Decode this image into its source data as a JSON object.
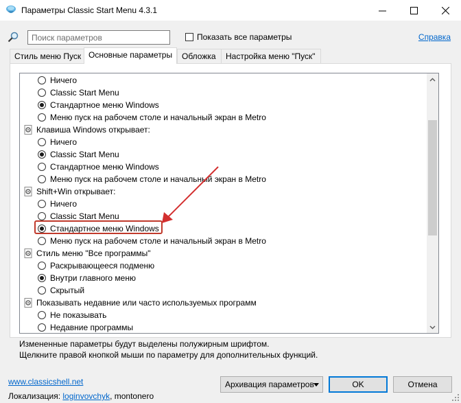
{
  "window": {
    "title": "Параметры Classic Start Menu 4.3.1"
  },
  "search": {
    "placeholder": "Поиск параметров",
    "value": ""
  },
  "show_all_label": "Показать все параметры",
  "help_link": "Справка",
  "tabs": [
    {
      "label": "Стиль меню Пуск",
      "active": false
    },
    {
      "label": "Основные параметры",
      "active": true
    },
    {
      "label": "Обложка",
      "active": false
    },
    {
      "label": "Настройка меню \"Пуск\"",
      "active": false
    }
  ],
  "settings": [
    {
      "type": "option",
      "label": "Ничего",
      "checked": false
    },
    {
      "type": "option",
      "label": "Classic Start Menu",
      "checked": false
    },
    {
      "type": "option",
      "label": "Стандартное меню Windows",
      "checked": true
    },
    {
      "type": "option",
      "label": "Меню пуск на рабочем столе и начальный экран в Metro",
      "checked": false
    },
    {
      "type": "group",
      "label": "Клавиша Windows открывает:"
    },
    {
      "type": "option",
      "label": "Ничего",
      "checked": false
    },
    {
      "type": "option",
      "label": "Classic Start Menu",
      "checked": true
    },
    {
      "type": "option",
      "label": "Стандартное меню Windows",
      "checked": false
    },
    {
      "type": "option",
      "label": "Меню пуск на рабочем столе и начальный экран в Metro",
      "checked": false
    },
    {
      "type": "group",
      "label": "Shift+Win открывает:"
    },
    {
      "type": "option",
      "label": "Ничего",
      "checked": false
    },
    {
      "type": "option",
      "label": "Classic Start Menu",
      "checked": false
    },
    {
      "type": "option",
      "label": "Стандартное меню Windows",
      "checked": true
    },
    {
      "type": "option",
      "label": "Меню пуск на рабочем столе и начальный экран в Metro",
      "checked": false
    },
    {
      "type": "group",
      "label": "Стиль меню \"Все программы\""
    },
    {
      "type": "option",
      "label": "Раскрывающееся подменю",
      "checked": false
    },
    {
      "type": "option",
      "label": "Внутри главного меню",
      "checked": true
    },
    {
      "type": "option",
      "label": "Скрытый",
      "checked": false
    },
    {
      "type": "group",
      "label": "Показывать недавние или часто используемых программ"
    },
    {
      "type": "option",
      "label": "Не показывать",
      "checked": false
    },
    {
      "type": "option",
      "label": "Недавние программы",
      "checked": false
    }
  ],
  "info": {
    "line1": "Измененные параметры будут выделены полужирным шрифтом.",
    "line2": "Щелкните правой кнопкой мыши по параметру для дополнительных функций."
  },
  "footer": {
    "site_link": "www.classicshell.net",
    "localization_label": "Локализация:",
    "localization_author": "loginvovchyk",
    "localization_rest": ", montonero"
  },
  "buttons": {
    "backup": "Архивация параметров",
    "ok": "OK",
    "cancel": "Отмена"
  },
  "colors": {
    "accent": "#0078d7",
    "highlight": "#c0392b",
    "link": "#0066cc"
  }
}
